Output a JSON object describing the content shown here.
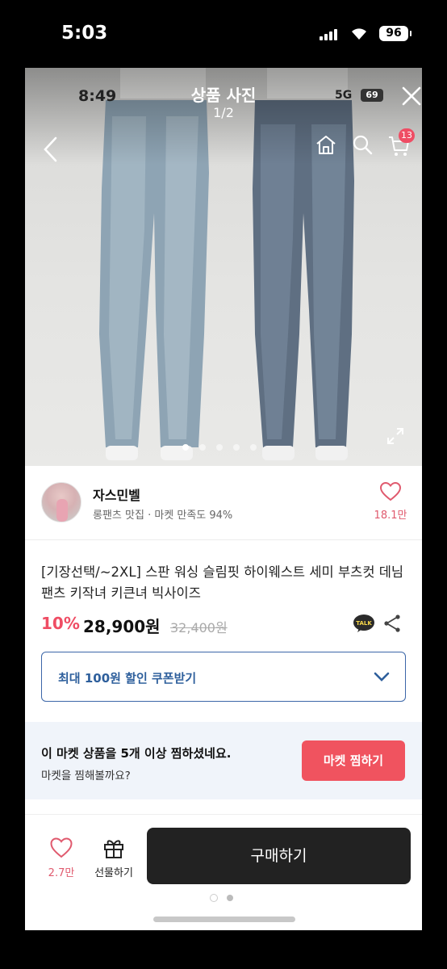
{
  "status_bar": {
    "time": "5:03",
    "battery": "96"
  },
  "inner_status": {
    "time": "8:49",
    "network": "5G",
    "battery": "69"
  },
  "viewer": {
    "title": "상품 사진",
    "counter": "1/2"
  },
  "nav": {
    "cart_count": "13"
  },
  "carousel": {
    "slide_count": 5,
    "active_index": 0
  },
  "seller": {
    "name": "자스민벨",
    "subtitle": "롱팬츠 맛집 · 마켓 만족도 94%",
    "likes": "18.1만"
  },
  "product": {
    "title": "[기장선택/~2XL] 스판 워싱 슬림핏 하이웨스트 세미 부츠컷 데님 팬츠 키작녀 키큰녀 빅사이즈",
    "discount": "10%",
    "price": "28,900원",
    "original_price": "32,400원"
  },
  "coupon": {
    "label": "최대 100원 할인 쿠폰받기"
  },
  "market_banner": {
    "title": "이 마켓 상품을 5개 이상 찜하셨네요.",
    "subtitle": "마켓을 찜해볼까요?",
    "button": "마켓 찜하기"
  },
  "bottom_bar": {
    "wish_count": "2.7만",
    "gift_label": "선물하기",
    "buy_label": "구매하기"
  },
  "colors": {
    "accent": "#ef4d64",
    "coupon_blue": "#2e5f9c",
    "buy_button": "#222222",
    "market_button": "#f0535f"
  }
}
